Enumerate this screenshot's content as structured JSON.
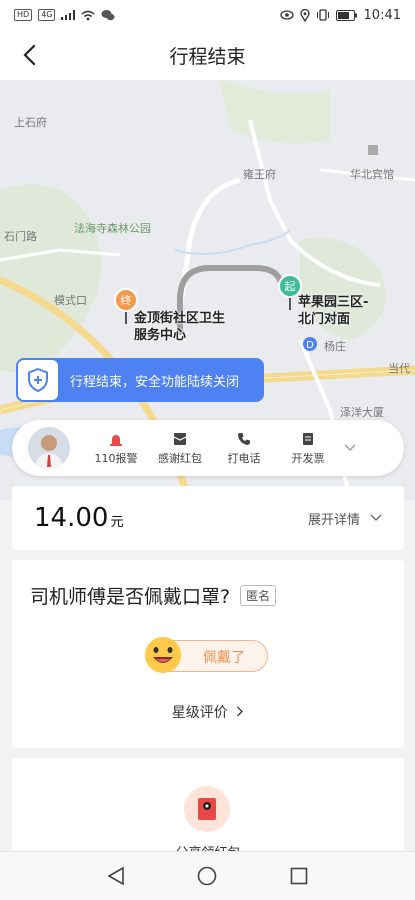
{
  "status_bar": {
    "time": "10:41",
    "chip_hd": "HD",
    "chip_4g": "4G"
  },
  "header": {
    "title": "行程结束",
    "back_icon": "chevron-left-icon"
  },
  "map": {
    "labels": [
      "上石府",
      "雍王府",
      "华北宾馆",
      "法海寺森林公园",
      "模式口",
      "杨庄",
      "当代",
      "泽洋大厦",
      "石门路"
    ],
    "end_point": {
      "pin": "终",
      "name_line1": "金顶街社区卫生",
      "name_line2": "服务中心"
    },
    "start_point": {
      "pin": "起",
      "name_line1": "苹果园三区-",
      "name_line2": "北门对面"
    }
  },
  "safety_banner": {
    "text": "行程结束，安全功能陆续关闭",
    "icon": "shield-plus-icon"
  },
  "driver_actions": [
    {
      "label": "110报警",
      "icon": "alarm-icon"
    },
    {
      "label": "感谢红包",
      "icon": "envelope-icon"
    },
    {
      "label": "打电话",
      "icon": "phone-icon"
    },
    {
      "label": "开发票",
      "icon": "invoice-icon"
    }
  ],
  "fare": {
    "amount": "14.00",
    "unit": "元",
    "expand_label": "展开详情"
  },
  "mask_survey": {
    "question": "司机师傅是否佩戴口罩?",
    "anonymous_badge": "匿名",
    "answer_label": "佩戴了",
    "star_rating_label": "星级评价"
  },
  "share": {
    "label": "分享领红包"
  },
  "colors": {
    "accent_blue": "#4e82f3",
    "end_pin": "#f39a4c",
    "start_pin": "#3dbd97",
    "orange_text": "#f08e4e"
  }
}
